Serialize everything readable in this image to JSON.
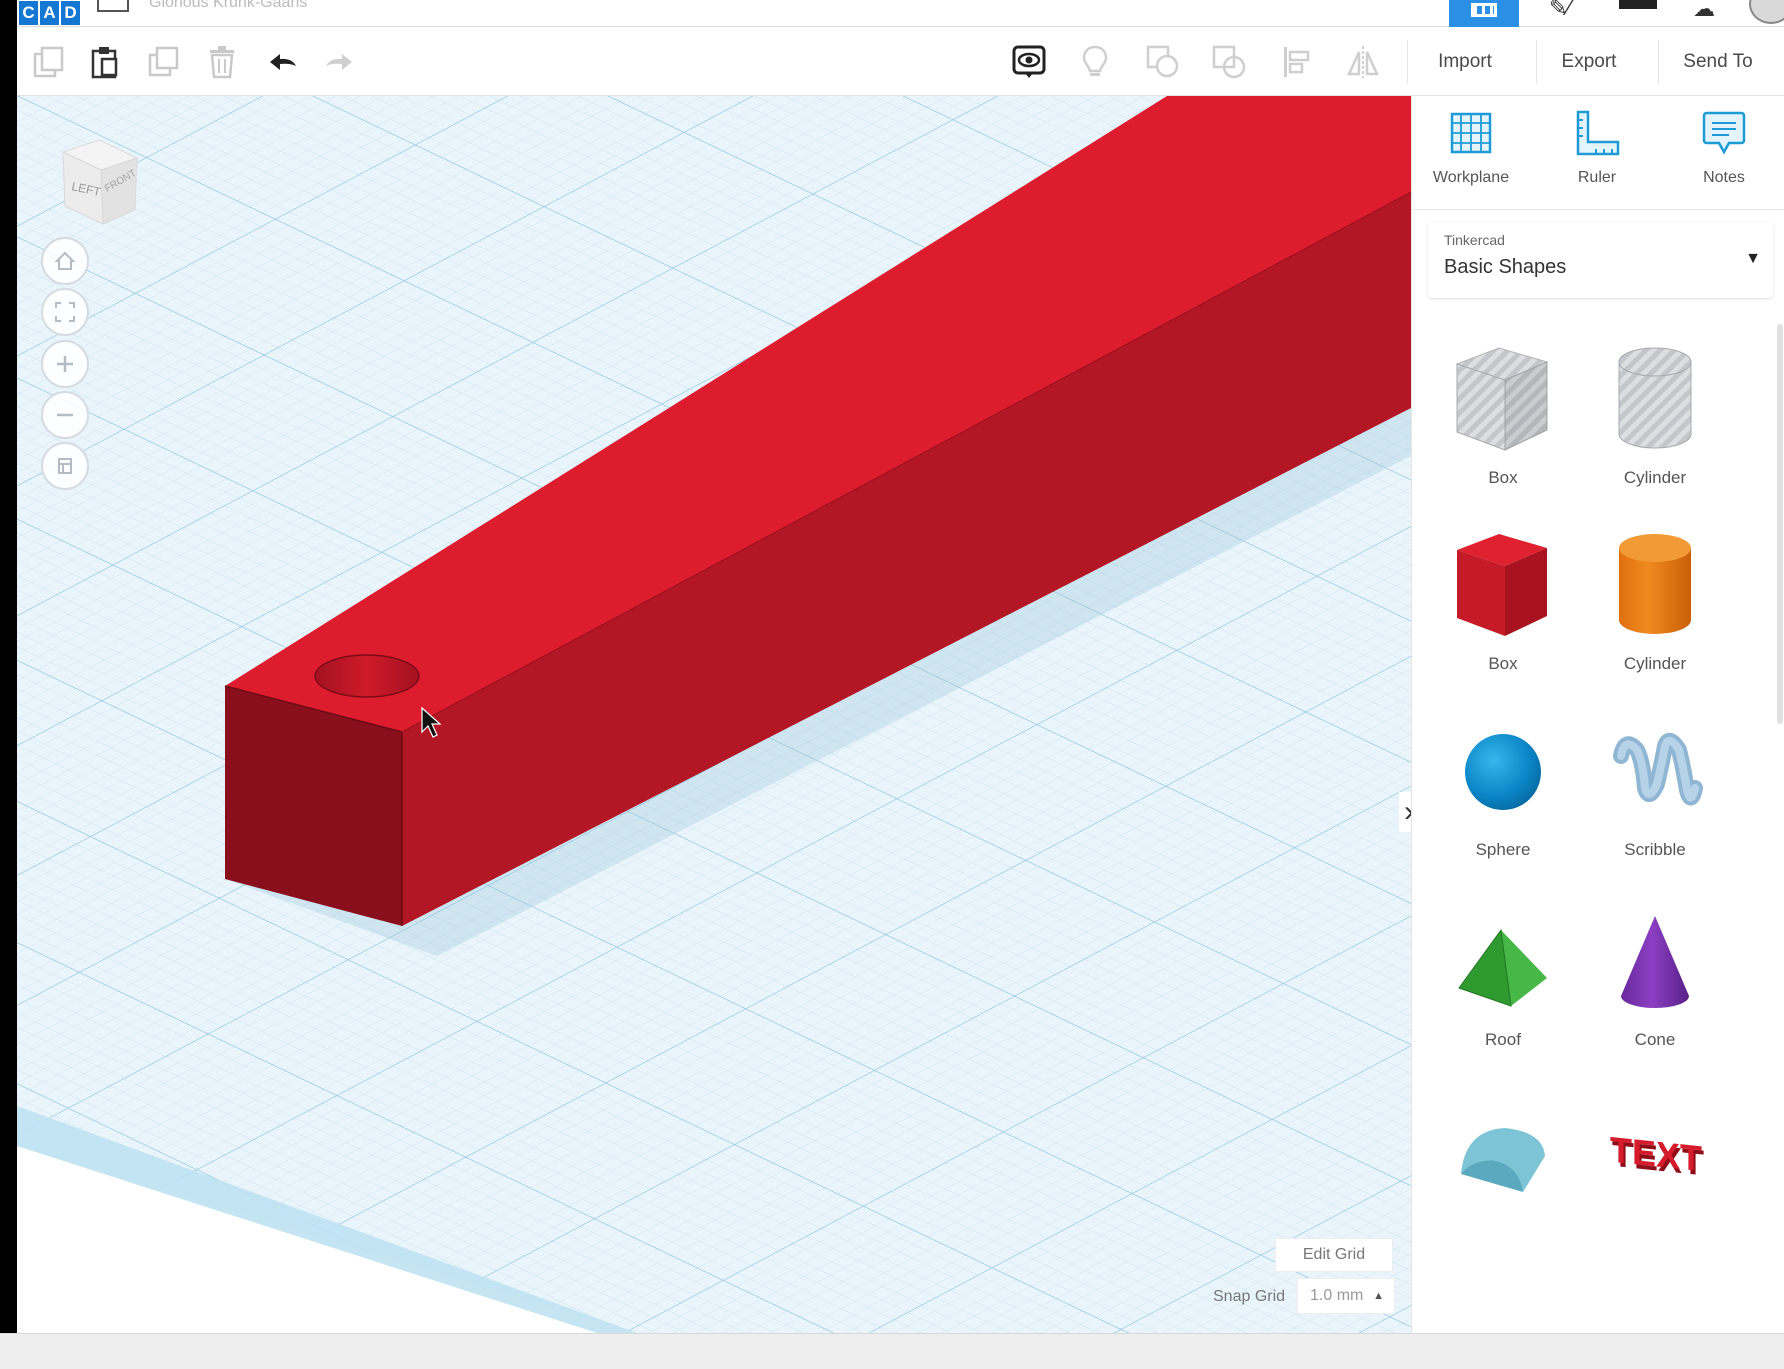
{
  "header": {
    "logo_letters": [
      "C",
      "A",
      "D"
    ],
    "title": "Glorious Krunk-Gaaris",
    "brand_color": "#1477d1"
  },
  "toolbar": {
    "import_label": "Import",
    "export_label": "Export",
    "send_to_label": "Send To",
    "icons": [
      "copy-icon",
      "paste-icon",
      "duplicate-icon",
      "delete-icon",
      "undo-icon",
      "redo-icon",
      "show-all-icon",
      "hide-icon",
      "group-icon",
      "ungroup-icon",
      "align-icon",
      "mirror-icon"
    ]
  },
  "viewcube": {
    "left_face": "LEFT",
    "front_face": "FRONT"
  },
  "view_controls": [
    "home-view-icon",
    "fit-all-icon",
    "zoom-in-icon",
    "zoom-out-icon",
    "ortho-perspective-icon"
  ],
  "workspace": {
    "edit_grid_label": "Edit Grid",
    "snap_grid_label": "Snap Grid",
    "snap_grid_value": "1.0 mm",
    "object_color": "#dd1c2d"
  },
  "right_panel": {
    "tools": [
      {
        "label": "Workplane",
        "icon": "workplane-icon"
      },
      {
        "label": "Ruler",
        "icon": "ruler-icon"
      },
      {
        "label": "Notes",
        "icon": "notes-icon"
      }
    ],
    "library_provider": "Tinkercad",
    "library_name": "Basic Shapes",
    "shapes": [
      {
        "label": "Box",
        "icon": "box-hole-icon"
      },
      {
        "label": "Cylinder",
        "icon": "cylinder-hole-icon"
      },
      {
        "label": "Box",
        "icon": "box-icon"
      },
      {
        "label": "Cylinder",
        "icon": "cylinder-icon"
      },
      {
        "label": "Sphere",
        "icon": "sphere-icon"
      },
      {
        "label": "Scribble",
        "icon": "scribble-icon"
      },
      {
        "label": "Roof",
        "icon": "roof-icon"
      },
      {
        "label": "Cone",
        "icon": "cone-icon"
      },
      {
        "label": "",
        "icon": "round-roof-icon"
      },
      {
        "label": "TEXT",
        "icon": "text-icon"
      }
    ]
  }
}
